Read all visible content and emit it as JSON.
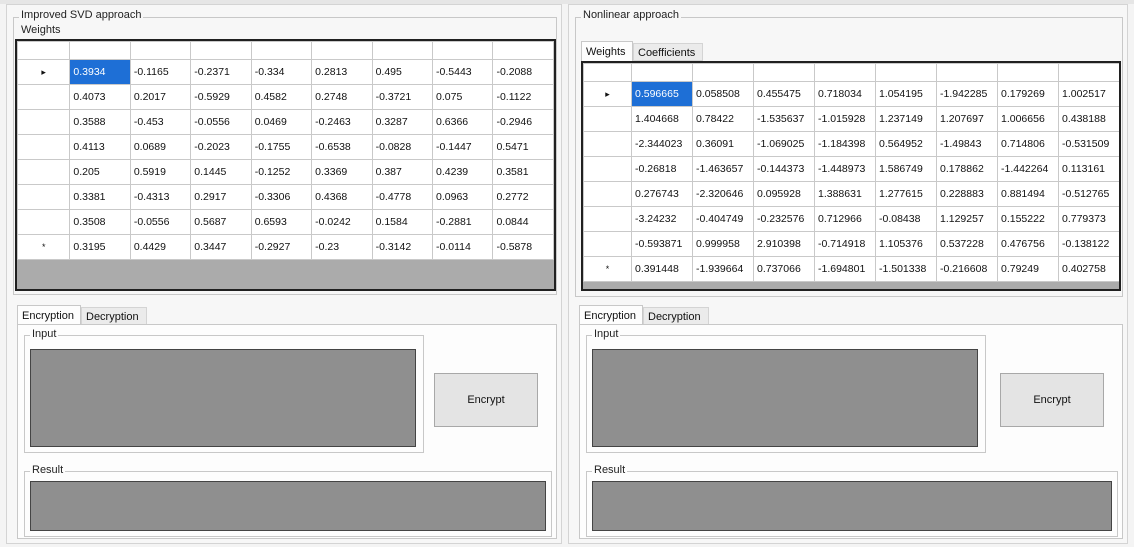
{
  "left": {
    "title": "Improved SVD approach",
    "grid_label": "Weights",
    "weights": [
      [
        "0.3934",
        "-0.1165",
        "-0.2371",
        "-0.334",
        "0.2813",
        "0.495",
        "-0.5443",
        "-0.2088"
      ],
      [
        "0.4073",
        "0.2017",
        "-0.5929",
        "0.4582",
        "0.2748",
        "-0.3721",
        "0.075",
        "-0.1122"
      ],
      [
        "0.3588",
        "-0.453",
        "-0.0556",
        "0.0469",
        "-0.2463",
        "0.3287",
        "0.6366",
        "-0.2946"
      ],
      [
        "0.4113",
        "0.0689",
        "-0.2023",
        "-0.1755",
        "-0.6538",
        "-0.0828",
        "-0.1447",
        "0.5471"
      ],
      [
        "0.205",
        "0.5919",
        "0.1445",
        "-0.1252",
        "0.3369",
        "0.387",
        "0.4239",
        "0.3581"
      ],
      [
        "0.3381",
        "-0.4313",
        "0.2917",
        "-0.3306",
        "0.4368",
        "-0.4778",
        "0.0963",
        "0.2772"
      ],
      [
        "0.3508",
        "-0.0556",
        "0.5687",
        "0.6593",
        "-0.0242",
        "0.1584",
        "-0.2881",
        "0.0844"
      ],
      [
        "0.3195",
        "0.4429",
        "0.3447",
        "-0.2927",
        "-0.23",
        "-0.3142",
        "-0.0114",
        "-0.5878"
      ]
    ],
    "row_markers": [
      "▸",
      "",
      "",
      "",
      "",
      "",
      "",
      "*"
    ],
    "tabs": [
      "Encryption",
      "Decryption"
    ],
    "input_label": "Input",
    "result_label": "Result",
    "encrypt_button": "Encrypt"
  },
  "right": {
    "title": "Nonlinear approach",
    "tabs_top": [
      "Weights",
      "Coefficients"
    ],
    "weights": [
      [
        "0.596665",
        "0.058508",
        "0.455475",
        "0.718034",
        "1.054195",
        "-1.942285",
        "0.179269",
        "1.002517"
      ],
      [
        "1.404668",
        "0.78422",
        "-1.535637",
        "-1.015928",
        "1.237149",
        "1.207697",
        "1.006656",
        "0.438188"
      ],
      [
        "-2.344023",
        "0.36091",
        "-1.069025",
        "-1.184398",
        "0.564952",
        "-1.49843",
        "0.714806",
        "-0.531509"
      ],
      [
        "-0.26818",
        "-1.463657",
        "-0.144373",
        "-1.448973",
        "1.586749",
        "0.178862",
        "-1.442264",
        "0.113161"
      ],
      [
        "0.276743",
        "-2.320646",
        "0.095928",
        "1.388631",
        "1.277615",
        "0.228883",
        "0.881494",
        "-0.512765"
      ],
      [
        "-3.24232",
        "-0.404749",
        "-0.232576",
        "0.712966",
        "-0.08438",
        "1.129257",
        "0.155222",
        "0.779373"
      ],
      [
        "-0.593871",
        "0.999958",
        "2.910398",
        "-0.714918",
        "1.105376",
        "0.537228",
        "0.476756",
        "-0.138122"
      ],
      [
        "0.391448",
        "-1.939664",
        "0.737066",
        "-1.694801",
        "-1.501338",
        "-0.216608",
        "0.79249",
        "0.402758"
      ]
    ],
    "row_markers": [
      "▸",
      "",
      "",
      "",
      "",
      "",
      "",
      "*"
    ],
    "tabs": [
      "Encryption",
      "Decryption"
    ],
    "input_label": "Input",
    "result_label": "Result",
    "encrypt_button": "Encrypt"
  }
}
